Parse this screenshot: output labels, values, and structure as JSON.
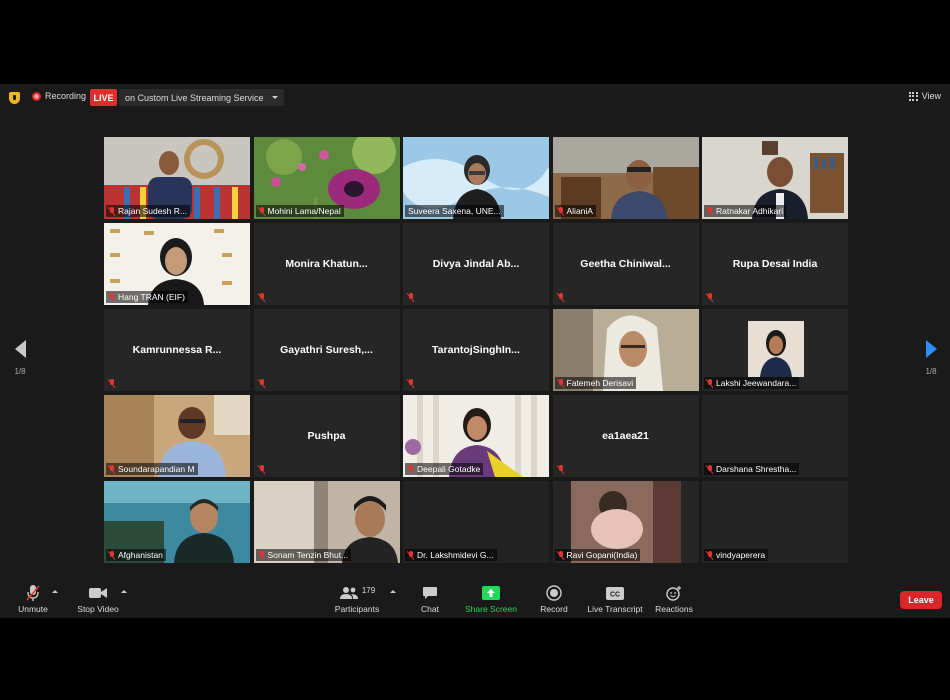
{
  "topbar": {
    "recording_label": "Recording",
    "live_badge": "LIVE",
    "stream_label": "on Custom Live Streaming Service",
    "view_label": "View"
  },
  "nav": {
    "left_page": "1/8",
    "right_page": "1/8"
  },
  "tiles": [
    {
      "name": "Rajan Sudesh R...",
      "video": true,
      "muted": true
    },
    {
      "name": "Mohini Lama/Nepal",
      "video": true,
      "muted": true
    },
    {
      "name": "Suveera Saxena, UNE...",
      "video": true,
      "muted": false,
      "active": true
    },
    {
      "name": "AlianiA",
      "video": true,
      "muted": true
    },
    {
      "name": "Ratnakar Adhikari",
      "video": true,
      "muted": true
    },
    {
      "name": "Hang TRAN (EIF)",
      "video": true,
      "muted": true
    },
    {
      "name": "Monira  Khatun...",
      "video": false,
      "muted": true
    },
    {
      "name": "Divya  Jindal  Ab...",
      "video": false,
      "muted": true
    },
    {
      "name": "Geetha  Chiniwal...",
      "video": false,
      "muted": true
    },
    {
      "name": "Rupa Desai India",
      "video": false,
      "muted": true
    },
    {
      "name": "Kamrunnessa  R...",
      "video": false,
      "muted": true
    },
    {
      "name": "Gayathri  Suresh,...",
      "video": false,
      "muted": true
    },
    {
      "name": "TarantojSinghIn...",
      "video": false,
      "muted": true
    },
    {
      "name": "Fatemeh Derisavi",
      "video": true,
      "muted": true
    },
    {
      "name": "Lakshi Jeewandara...",
      "video": true,
      "muted": true
    },
    {
      "name": "Soundarapandian M",
      "video": true,
      "muted": true
    },
    {
      "name": "Pushpa",
      "video": false,
      "muted": true
    },
    {
      "name": "Deepali Gotadke",
      "video": true,
      "muted": true
    },
    {
      "name": "ea1aea21",
      "video": false,
      "muted": true
    },
    {
      "name": "Darshana Shrestha...",
      "video": true,
      "muted": true
    },
    {
      "name": "Afghanistan",
      "video": true,
      "muted": true
    },
    {
      "name": "Sonam Tenzin Bhut...",
      "video": true,
      "muted": true
    },
    {
      "name": "Dr.  Lakshmidevi G...",
      "video": true,
      "muted": true
    },
    {
      "name": "Ravi Gopani(India)",
      "video": true,
      "muted": true
    },
    {
      "name": "vindyaperera",
      "video": true,
      "muted": true
    }
  ],
  "toolbar": {
    "unmute": "Unmute",
    "stop_video": "Stop Video",
    "participants": "Participants",
    "participants_count": "179",
    "chat": "Chat",
    "share_screen": "Share Screen",
    "record": "Record",
    "live_transcript": "Live Transcript",
    "reactions": "Reactions",
    "leave": "Leave"
  },
  "colors": {
    "live_red": "#e02d2d",
    "share_green": "#23d959",
    "active_speaker": "#e4e81e",
    "nav_blue": "#2e8cf5",
    "leave_red": "#d9262b"
  }
}
